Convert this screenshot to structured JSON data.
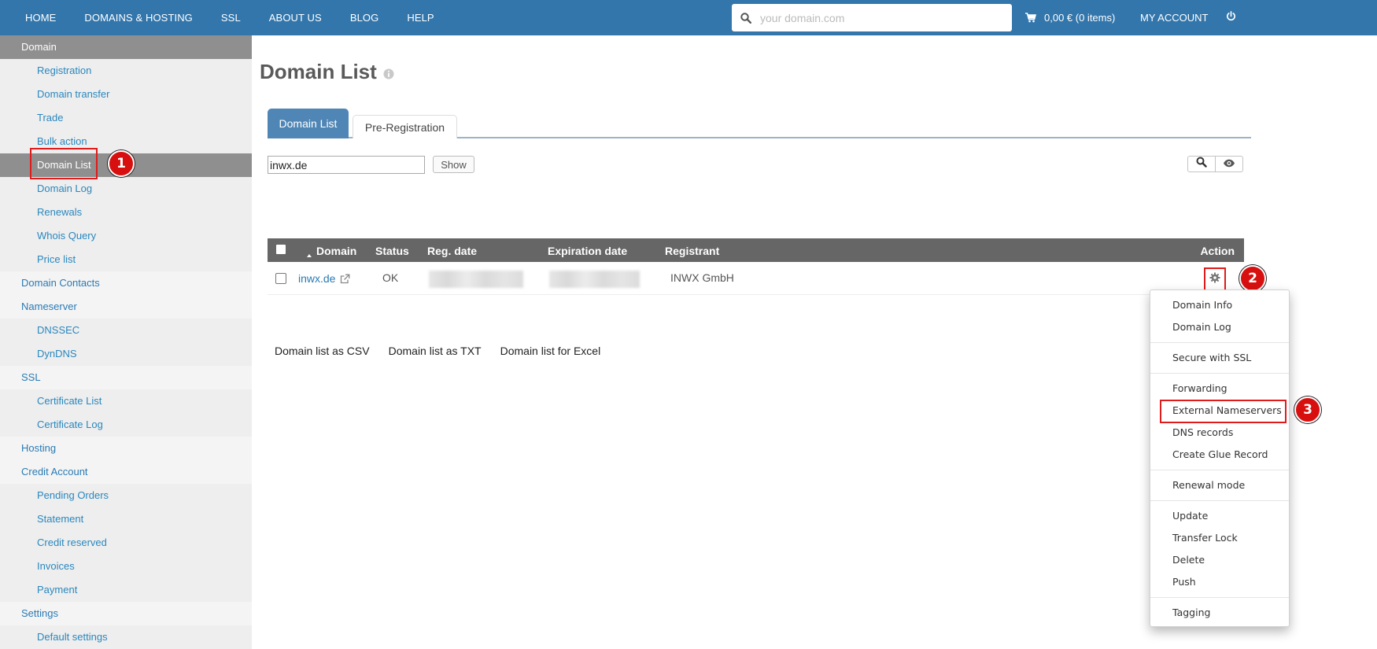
{
  "topnav": {
    "items": [
      "HOME",
      "DOMAINS & HOSTING",
      "SSL",
      "ABOUT US",
      "BLOG",
      "HELP"
    ],
    "search_placeholder": "your domain.com",
    "search_icon": "search-icon",
    "cart_icon": "cart-icon",
    "cart_label": "0,00 € (0 items)",
    "account_label": "MY ACCOUNT",
    "logout_icon": "power-icon"
  },
  "sidebar": {
    "items": [
      {
        "label": "Domain",
        "level": "section"
      },
      {
        "label": "Registration",
        "level": "sub"
      },
      {
        "label": "Domain transfer",
        "level": "sub"
      },
      {
        "label": "Trade",
        "level": "sub"
      },
      {
        "label": "Bulk action",
        "level": "sub"
      },
      {
        "label": "Domain List",
        "level": "sub",
        "active": true
      },
      {
        "label": "Domain Log",
        "level": "sub"
      },
      {
        "label": "Renewals",
        "level": "sub"
      },
      {
        "label": "Whois Query",
        "level": "sub"
      },
      {
        "label": "Price list",
        "level": "sub"
      },
      {
        "label": "Domain Contacts",
        "level": "top"
      },
      {
        "label": "Nameserver",
        "level": "top"
      },
      {
        "label": "DNSSEC",
        "level": "sub"
      },
      {
        "label": "DynDNS",
        "level": "sub"
      },
      {
        "label": "SSL",
        "level": "top"
      },
      {
        "label": "Certificate List",
        "level": "sub"
      },
      {
        "label": "Certificate Log",
        "level": "sub"
      },
      {
        "label": "Hosting",
        "level": "top"
      },
      {
        "label": "Credit Account",
        "level": "top"
      },
      {
        "label": "Pending Orders",
        "level": "sub"
      },
      {
        "label": "Statement",
        "level": "sub"
      },
      {
        "label": "Credit reserved",
        "level": "sub"
      },
      {
        "label": "Invoices",
        "level": "sub"
      },
      {
        "label": "Payment",
        "level": "sub"
      },
      {
        "label": "Settings",
        "level": "top"
      },
      {
        "label": "Default settings",
        "level": "sub"
      }
    ]
  },
  "annotations": {
    "step1": "1",
    "step2": "2",
    "step3": "3",
    "highlight_color": "#e01b1b"
  },
  "main": {
    "title": "Domain List",
    "info_icon": "info-icon",
    "tabs": [
      {
        "label": "Domain List",
        "active": true
      },
      {
        "label": "Pre-Registration",
        "active": false
      }
    ],
    "filter": {
      "value": "inwx.de",
      "show_label": "Show"
    },
    "table": {
      "columns": [
        "",
        "Domain",
        "Status",
        "Reg. date",
        "Expiration date",
        "Registrant",
        "Action"
      ],
      "sorted_column": "Domain",
      "rows": [
        {
          "domain": "inwx.de",
          "status": "OK",
          "reg_date": "",
          "expiration_date": "",
          "registrant": "INWX GmbH"
        }
      ]
    },
    "exports": [
      "Domain list as CSV",
      "Domain list as TXT",
      "Domain list for Excel"
    ]
  },
  "action_menu": {
    "groups": [
      [
        "Domain Info",
        "Domain Log"
      ],
      [
        "Secure with SSL"
      ],
      [
        "Forwarding",
        "External Nameservers",
        "DNS records",
        "Create Glue Record"
      ],
      [
        "Renewal mode"
      ],
      [
        "Update",
        "Transfer Lock",
        "Delete",
        "Push"
      ],
      [
        "Tagging"
      ]
    ],
    "highlighted": "External Nameservers"
  },
  "colors": {
    "brand": "#3276ac",
    "tab_active": "#4f86b6",
    "link": "#2a7ab4",
    "table_header": "#666666"
  }
}
